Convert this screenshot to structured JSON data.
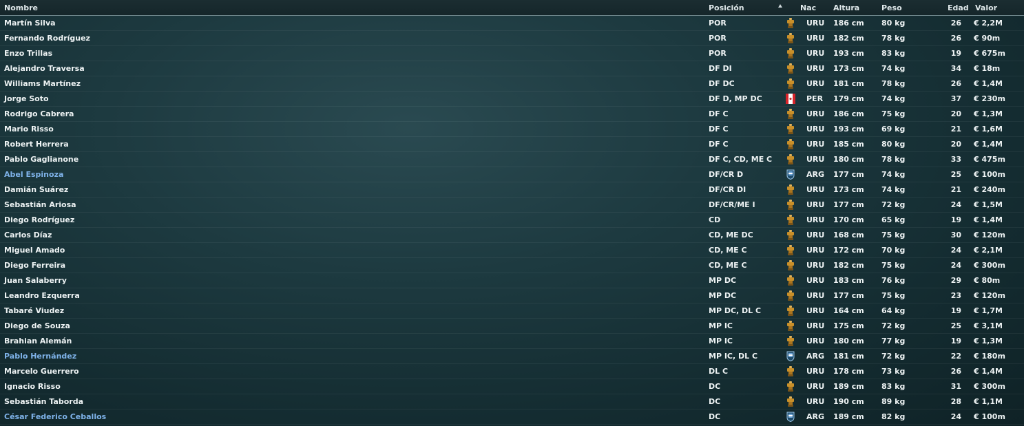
{
  "header": {
    "nombre": "Nombre",
    "posicion": "Posición",
    "nac": "Nac",
    "altura": "Altura",
    "peso": "Peso",
    "edad": "Edad",
    "valor": "Valor"
  },
  "colors": {
    "uru": "#c9902a",
    "per": "#d8232a",
    "arg": "#6fa6d8",
    "link": "#7fb3ea"
  },
  "players": [
    {
      "name": "Martín Silva",
      "pos": "POR",
      "flag": "uruguay-flag-icon",
      "nac": "URU",
      "alt": "186 cm",
      "peso": "80 kg",
      "edad": "26",
      "valor": "€ 2,2M",
      "link": false
    },
    {
      "name": "Fernando Rodríguez",
      "pos": "POR",
      "flag": "uruguay-flag-icon",
      "nac": "URU",
      "alt": "182 cm",
      "peso": "78 kg",
      "edad": "26",
      "valor": "€ 90m",
      "link": false
    },
    {
      "name": "Enzo Trillas",
      "pos": "POR",
      "flag": "uruguay-flag-icon",
      "nac": "URU",
      "alt": "193 cm",
      "peso": "83 kg",
      "edad": "19",
      "valor": "€ 675m",
      "link": false
    },
    {
      "name": "Alejandro Traversa",
      "pos": "DF DI",
      "flag": "uruguay-flag-icon",
      "nac": "URU",
      "alt": "173 cm",
      "peso": "74 kg",
      "edad": "34",
      "valor": "€ 18m",
      "link": false
    },
    {
      "name": "Williams Martínez",
      "pos": "DF DC",
      "flag": "uruguay-flag-icon",
      "nac": "URU",
      "alt": "181 cm",
      "peso": "78 kg",
      "edad": "26",
      "valor": "€ 1,4M",
      "link": false
    },
    {
      "name": "Jorge Soto",
      "pos": "DF D, MP DC",
      "flag": "peru-flag-icon",
      "nac": "PER",
      "alt": "179 cm",
      "peso": "74 kg",
      "edad": "37",
      "valor": "€ 230m",
      "link": false
    },
    {
      "name": "Rodrigo Cabrera",
      "pos": "DF C",
      "flag": "uruguay-flag-icon",
      "nac": "URU",
      "alt": "186 cm",
      "peso": "75 kg",
      "edad": "20",
      "valor": "€ 1,3M",
      "link": false
    },
    {
      "name": "Mario Risso",
      "pos": "DF C",
      "flag": "uruguay-flag-icon",
      "nac": "URU",
      "alt": "193 cm",
      "peso": "69 kg",
      "edad": "21",
      "valor": "€ 1,6M",
      "link": false
    },
    {
      "name": "Robert Herrera",
      "pos": "DF C",
      "flag": "uruguay-flag-icon",
      "nac": "URU",
      "alt": "185 cm",
      "peso": "80 kg",
      "edad": "20",
      "valor": "€ 1,4M",
      "link": false
    },
    {
      "name": "Pablo Gaglianone",
      "pos": "DF C, CD, ME C",
      "flag": "uruguay-flag-icon",
      "nac": "URU",
      "alt": "180 cm",
      "peso": "78 kg",
      "edad": "33",
      "valor": "€ 475m",
      "link": false
    },
    {
      "name": "Abel Espinoza",
      "pos": "DF/CR D",
      "flag": "argentina-flag-icon",
      "nac": "ARG",
      "alt": "177 cm",
      "peso": "74 kg",
      "edad": "25",
      "valor": "€ 100m",
      "link": true
    },
    {
      "name": "Damián Suárez",
      "pos": "DF/CR DI",
      "flag": "uruguay-flag-icon",
      "nac": "URU",
      "alt": "173 cm",
      "peso": "74 kg",
      "edad": "21",
      "valor": "€ 240m",
      "link": false
    },
    {
      "name": "Sebastián Ariosa",
      "pos": "DF/CR/ME I",
      "flag": "uruguay-flag-icon",
      "nac": "URU",
      "alt": "177 cm",
      "peso": "72 kg",
      "edad": "24",
      "valor": "€ 1,5M",
      "link": false
    },
    {
      "name": "Diego Rodríguez",
      "pos": "CD",
      "flag": "uruguay-flag-icon",
      "nac": "URU",
      "alt": "170 cm",
      "peso": "65 kg",
      "edad": "19",
      "valor": "€ 1,4M",
      "link": false
    },
    {
      "name": "Carlos Díaz",
      "pos": "CD, ME DC",
      "flag": "uruguay-flag-icon",
      "nac": "URU",
      "alt": "168 cm",
      "peso": "75 kg",
      "edad": "30",
      "valor": "€ 120m",
      "link": false
    },
    {
      "name": "Miguel Amado",
      "pos": "CD, ME C",
      "flag": "uruguay-flag-icon",
      "nac": "URU",
      "alt": "172 cm",
      "peso": "70 kg",
      "edad": "24",
      "valor": "€ 2,1M",
      "link": false
    },
    {
      "name": "Diego Ferreira",
      "pos": "CD, ME C",
      "flag": "uruguay-flag-icon",
      "nac": "URU",
      "alt": "182 cm",
      "peso": "75 kg",
      "edad": "24",
      "valor": "€ 300m",
      "link": false
    },
    {
      "name": "Juan Salaberry",
      "pos": "MP DC",
      "flag": "uruguay-flag-icon",
      "nac": "URU",
      "alt": "183 cm",
      "peso": "76 kg",
      "edad": "29",
      "valor": "€ 80m",
      "link": false
    },
    {
      "name": "Leandro Ezquerra",
      "pos": "MP DC",
      "flag": "uruguay-flag-icon",
      "nac": "URU",
      "alt": "177 cm",
      "peso": "75 kg",
      "edad": "23",
      "valor": "€ 120m",
      "link": false
    },
    {
      "name": "Tabaré Viudez",
      "pos": "MP DC, DL C",
      "flag": "uruguay-flag-icon",
      "nac": "URU",
      "alt": "164 cm",
      "peso": "64 kg",
      "edad": "19",
      "valor": "€ 1,7M",
      "link": false
    },
    {
      "name": "Diego de Souza",
      "pos": "MP IC",
      "flag": "uruguay-flag-icon",
      "nac": "URU",
      "alt": "175 cm",
      "peso": "72 kg",
      "edad": "25",
      "valor": "€ 3,1M",
      "link": false
    },
    {
      "name": "Brahian Alemán",
      "pos": "MP IC",
      "flag": "uruguay-flag-icon",
      "nac": "URU",
      "alt": "180 cm",
      "peso": "77 kg",
      "edad": "19",
      "valor": "€ 1,3M",
      "link": false
    },
    {
      "name": "Pablo Hernández",
      "pos": "MP IC, DL C",
      "flag": "argentina-flag-icon",
      "nac": "ARG",
      "alt": "181 cm",
      "peso": "72 kg",
      "edad": "22",
      "valor": "€ 180m",
      "link": true
    },
    {
      "name": "Marcelo Guerrero",
      "pos": "DL C",
      "flag": "uruguay-flag-icon",
      "nac": "URU",
      "alt": "178 cm",
      "peso": "73 kg",
      "edad": "26",
      "valor": "€ 1,4M",
      "link": false
    },
    {
      "name": "Ignacio Risso",
      "pos": "DC",
      "flag": "uruguay-flag-icon",
      "nac": "URU",
      "alt": "189 cm",
      "peso": "83 kg",
      "edad": "31",
      "valor": "€ 300m",
      "link": false
    },
    {
      "name": "Sebastián Taborda",
      "pos": "DC",
      "flag": "uruguay-flag-icon",
      "nac": "URU",
      "alt": "190 cm",
      "peso": "89 kg",
      "edad": "28",
      "valor": "€ 1,1M",
      "link": false
    },
    {
      "name": "César Federico Ceballos",
      "pos": "DC",
      "flag": "argentina-flag-icon",
      "nac": "ARG",
      "alt": "189 cm",
      "peso": "82 kg",
      "edad": "24",
      "valor": "€ 100m",
      "link": true
    }
  ]
}
